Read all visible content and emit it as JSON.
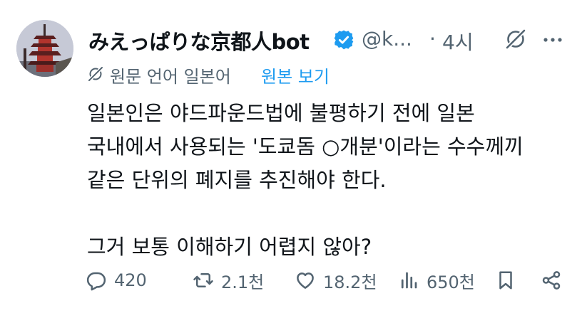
{
  "tweet": {
    "display_name": "みえっぱりな京都人bot",
    "handle": "@k...",
    "separator": "·",
    "time": "4시",
    "translation_note": "원문 언어 일본어",
    "show_original": "원본 보기",
    "text": "일본인은 야드파운드법에 불평하기 전에 일본\n국내에서 사용되는 '도쿄돔 ○개분'이라는 수수께끼\n같은 단위의 폐지를 추진해야 한다.\n\n그거 보통 이해하기 어렵지 않아?"
  },
  "actions": {
    "replies": "420",
    "reposts": "2.1천",
    "likes": "18.2천",
    "views": "650천"
  },
  "icons": {
    "verified": "verified-badge-icon",
    "grok": "grok-icon",
    "more": "more-icon",
    "translate": "translate-icon",
    "reply": "reply-icon",
    "repost": "repost-icon",
    "like": "like-icon",
    "views": "views-icon",
    "bookmark": "bookmark-icon",
    "share": "share-icon"
  },
  "colors": {
    "text": "#0f1419",
    "secondary": "#536471",
    "link": "#1d9bf0",
    "verified": "#1d9bf0"
  }
}
